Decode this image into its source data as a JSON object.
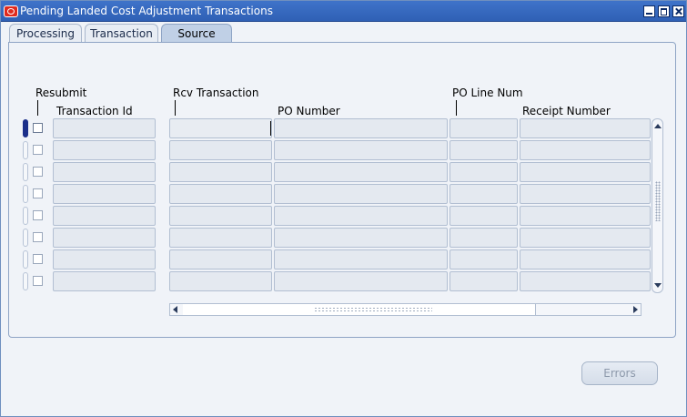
{
  "window": {
    "title": "Pending Landed Cost Adjustment Transactions",
    "buttons": {
      "minimize": "minimize-icon",
      "maximize": "maximize-icon",
      "close": "close-icon"
    }
  },
  "tabs": [
    {
      "label": "Processing",
      "active": false
    },
    {
      "label": "Transaction",
      "active": false
    },
    {
      "label": "Source",
      "active": true
    }
  ],
  "table": {
    "headers": {
      "resubmit": "Resubmit",
      "transaction_id": "Transaction Id",
      "rcv_transaction": "Rcv Transaction",
      "po_number": "PO Number",
      "po_line_num": "PO Line Num",
      "receipt_number": "Receipt Number"
    },
    "rows": [
      {
        "resubmit": false,
        "transaction_id": "",
        "rcv_transaction": "",
        "po_number": "",
        "po_line_num": "",
        "receipt_number": ""
      },
      {
        "resubmit": false,
        "transaction_id": "",
        "rcv_transaction": "",
        "po_number": "",
        "po_line_num": "",
        "receipt_number": ""
      },
      {
        "resubmit": false,
        "transaction_id": "",
        "rcv_transaction": "",
        "po_number": "",
        "po_line_num": "",
        "receipt_number": ""
      },
      {
        "resubmit": false,
        "transaction_id": "",
        "rcv_transaction": "",
        "po_number": "",
        "po_line_num": "",
        "receipt_number": ""
      },
      {
        "resubmit": false,
        "transaction_id": "",
        "rcv_transaction": "",
        "po_number": "",
        "po_line_num": "",
        "receipt_number": ""
      },
      {
        "resubmit": false,
        "transaction_id": "",
        "rcv_transaction": "",
        "po_number": "",
        "po_line_num": "",
        "receipt_number": ""
      },
      {
        "resubmit": false,
        "transaction_id": "",
        "rcv_transaction": "",
        "po_number": "",
        "po_line_num": "",
        "receipt_number": ""
      },
      {
        "resubmit": false,
        "transaction_id": "",
        "rcv_transaction": "",
        "po_number": "",
        "po_line_num": "",
        "receipt_number": ""
      }
    ]
  },
  "buttons": {
    "errors": "Errors"
  },
  "colors": {
    "titlebar": "#3f73c9",
    "active_tab": "#c0d0e6",
    "field": "#e4e9f0",
    "current_record": "#1b2f8a"
  }
}
